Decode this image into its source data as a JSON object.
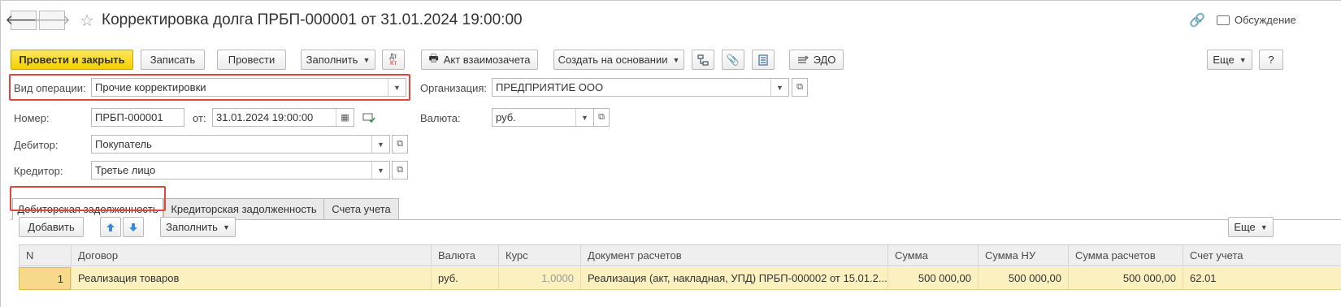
{
  "header": {
    "title": "Корректировка долга ПРБП-000001 от 31.01.2024 19:00:00",
    "back_glyph": "🡐",
    "forward_glyph": "🡒",
    "discuss_label": "Обсуждение"
  },
  "toolbar": {
    "post_close": "Провести и закрыть",
    "save": "Записать",
    "post": "Провести",
    "fill": "Заполнить",
    "dt_kt": "Дт Кт",
    "act": "Акт взаимозачета",
    "create_based": "Создать на основании",
    "edo": "ЭДО",
    "more": "Еще",
    "help": "?"
  },
  "form": {
    "op_type_label": "Вид операции:",
    "op_type_value": "Прочие корректировки",
    "org_label": "Организация:",
    "org_value": "ПРЕДПРИЯТИЕ ООО",
    "number_label": "Номер:",
    "number_value": "ПРБП-000001",
    "date_label": "от:",
    "date_value": "31.01.2024 19:00:00",
    "currency_label": "Валюта:",
    "currency_value": "руб.",
    "debtor_label": "Дебитор:",
    "debtor_value": "Покупатель",
    "creditor_label": "Кредитор:",
    "creditor_value": "Третье лицо"
  },
  "tabs": [
    {
      "label": "Дебиторская задолженность",
      "active": true
    },
    {
      "label": "Кредиторская задолженность",
      "active": false
    },
    {
      "label": "Счета учета",
      "active": false
    }
  ],
  "table_toolbar": {
    "add": "Добавить",
    "fill": "Заполнить",
    "more": "Еще"
  },
  "table": {
    "columns": [
      "N",
      "Договор",
      "Валюта",
      "Курс",
      "Документ расчетов",
      "Сумма",
      "Сумма НУ",
      "Сумма расчетов",
      "Счет учета"
    ],
    "rows": [
      [
        "1",
        "Реализация товаров",
        "руб.",
        "1,0000",
        "Реализация (акт, накладная, УПД) ПРБП-000002 от 15.01.2...",
        "500 000,00",
        "500 000,00",
        "500 000,00",
        "62.01"
      ]
    ]
  },
  "colors": {
    "primary_button": "#f5d000",
    "highlight_border": "#e0473d",
    "selected_row": "#fbf0c0"
  }
}
